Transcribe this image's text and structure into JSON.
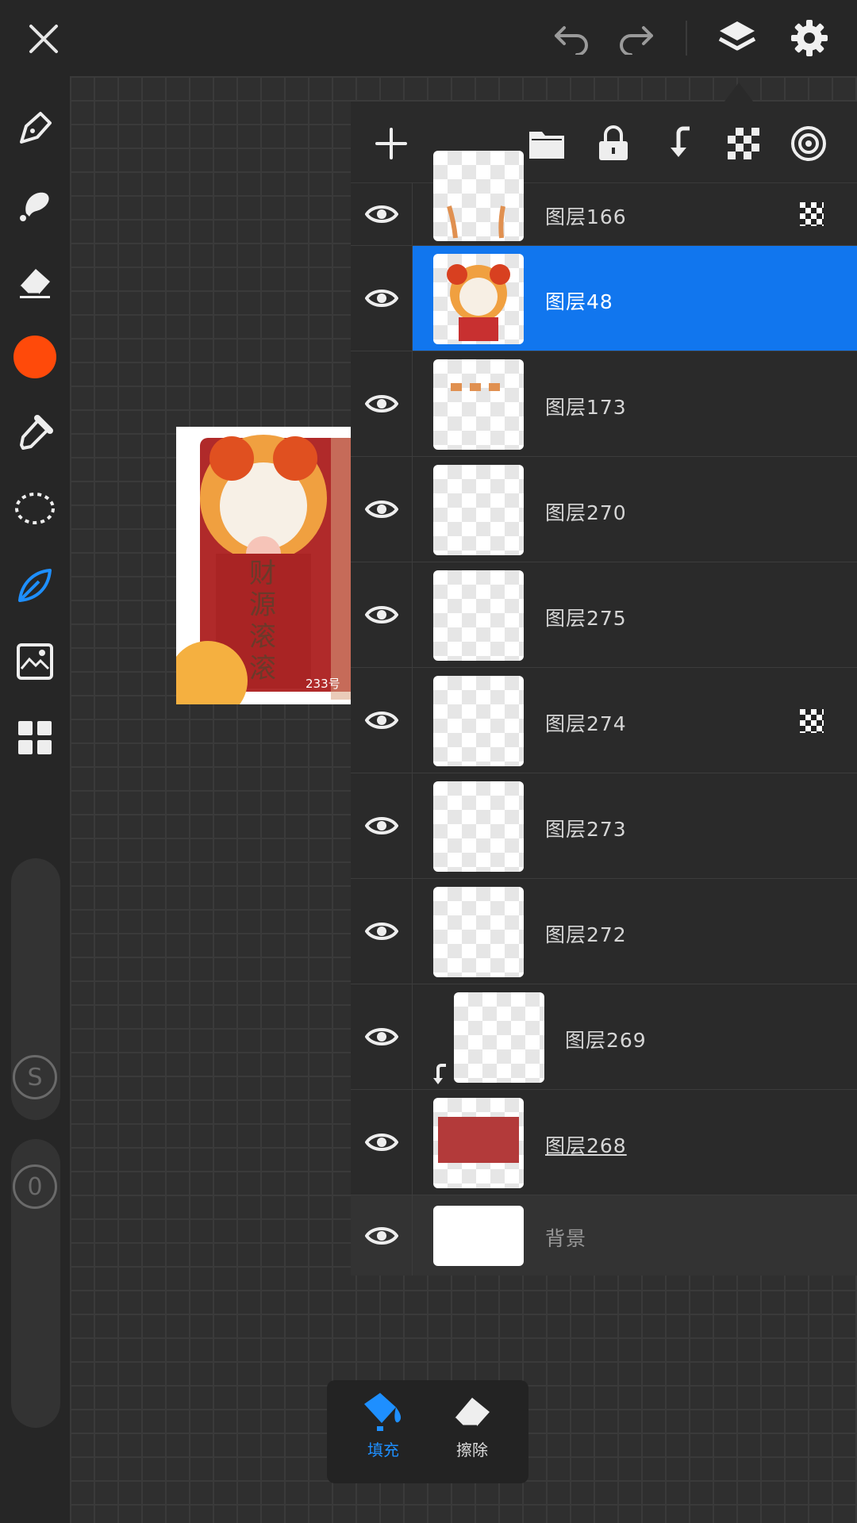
{
  "topbar": {
    "close_icon": "close-icon",
    "undo_icon": "undo-icon",
    "redo_icon": "redo-icon",
    "layers_icon": "layers-icon",
    "settings_icon": "gear-icon"
  },
  "toolbar": {
    "tools": [
      "pen-icon",
      "smudge-brush-icon",
      "eraser-icon",
      "color-swatch",
      "eyedropper-icon",
      "lasso-icon",
      "leaf-brush-icon",
      "image-import-icon",
      "grid-menu-icon"
    ],
    "active_color": "#ff4a0a",
    "accent_color": "#1e8fff",
    "size_slider_label": "S",
    "opacity_slider_label": "0"
  },
  "layers_panel": {
    "toolbar_icons": [
      "add-layer-icon",
      "folder-icon",
      "lock-icon",
      "clip-icon",
      "alpha-lock-icon",
      "target-icon"
    ],
    "layers": [
      {
        "name": "图层166",
        "alpha_locked": true,
        "selected": false
      },
      {
        "name": "图层48",
        "alpha_locked": false,
        "selected": true
      },
      {
        "name": "图层173",
        "alpha_locked": false,
        "selected": false
      },
      {
        "name": "图层270",
        "alpha_locked": false,
        "selected": false
      },
      {
        "name": "图层275",
        "alpha_locked": false,
        "selected": false
      },
      {
        "name": "图层274",
        "alpha_locked": true,
        "selected": false
      },
      {
        "name": "图层273",
        "alpha_locked": false,
        "selected": false
      },
      {
        "name": "图层272",
        "alpha_locked": false,
        "selected": false
      },
      {
        "name": "图层269",
        "alpha_locked": false,
        "selected": false,
        "clipped": true
      },
      {
        "name": "图层268",
        "alpha_locked": false,
        "selected": false
      },
      {
        "name": "背景",
        "alpha_locked": false,
        "selected": false
      }
    ]
  },
  "artwork": {
    "chars": [
      "财",
      "源",
      "滚",
      "滚"
    ],
    "tag": "233号"
  },
  "bottom_palette": {
    "fill_label": "填充",
    "erase_label": "擦除"
  }
}
